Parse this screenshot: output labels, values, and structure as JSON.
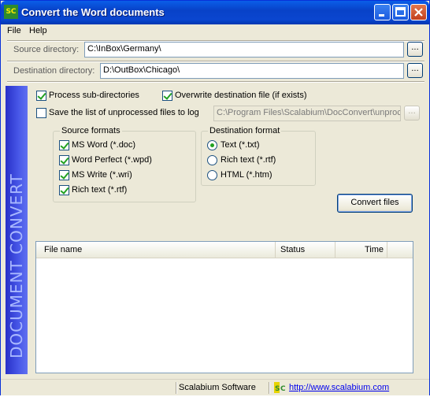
{
  "window": {
    "title": "Convert the Word documents",
    "icon_text": "SC"
  },
  "menu": {
    "file": "File",
    "help": "Help"
  },
  "source": {
    "label": "Source directory:",
    "value": "C:\\InBox\\Germany\\",
    "browse": "..."
  },
  "destination": {
    "label": "Destination directory:",
    "value": "D:\\OutBox\\Chicago\\",
    "browse": "..."
  },
  "sidebar": {
    "text": "DOCUMENT CONVERT"
  },
  "options": {
    "process_subdirs": {
      "label": "Process sub-directories",
      "checked": true
    },
    "overwrite": {
      "label": "Overwrite destination file (if exists)",
      "checked": true
    },
    "save_log": {
      "label": "Save the list of unprocessed files to log",
      "checked": false
    },
    "log_path": "C:\\Program Files\\Scalabium\\DocConvert\\unproc",
    "log_browse": "..."
  },
  "source_formats": {
    "title": "Source formats",
    "items": [
      {
        "label": "MS Word (*.doc)",
        "checked": true
      },
      {
        "label": "Word Perfect (*.wpd)",
        "checked": true
      },
      {
        "label": "MS Write (*.wri)",
        "checked": true
      },
      {
        "label": "Rich text (*.rtf)",
        "checked": true
      }
    ]
  },
  "destination_format": {
    "title": "Destination format",
    "items": [
      {
        "label": "Text (*.txt)",
        "selected": true
      },
      {
        "label": "Rich text (*.rtf)",
        "selected": false
      },
      {
        "label": "HTML (*.htm)",
        "selected": false
      }
    ]
  },
  "convert_button": "Convert files",
  "file_list": {
    "columns": [
      "File name",
      "Status",
      "Time"
    ]
  },
  "statusbar": {
    "company": "Scalabium Software",
    "link": "http://www.scalabium.com"
  },
  "colors": {
    "titlebar": "#0a5ee8",
    "sidebar": "#3a44d8",
    "check": "#21a121"
  }
}
